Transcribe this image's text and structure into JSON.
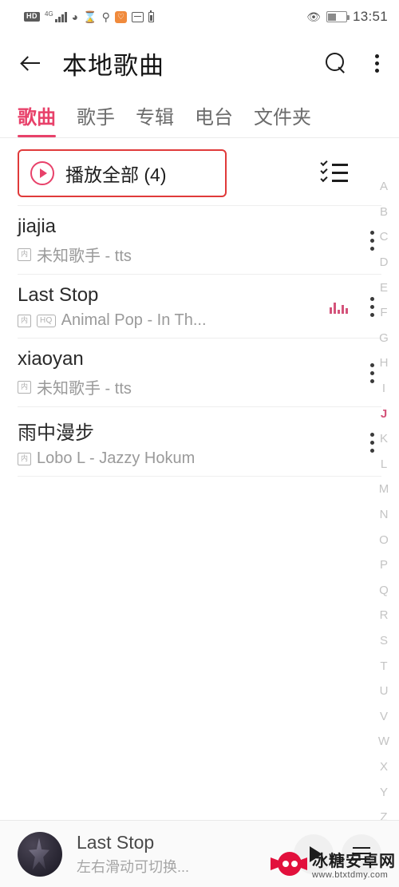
{
  "statusbar": {
    "hd_badge": "HD",
    "network": "4G",
    "icons": [
      "hd-badge",
      "signal-4g-icon",
      "wifi-icon",
      "hourglass-icon",
      "accessibility-icon",
      "orange-app-icon",
      "inbox-icon",
      "battery-small-icon"
    ],
    "eye_icon": "eye-icon",
    "battery_level": 40,
    "time": "13:51"
  },
  "header": {
    "back_label": "←",
    "title": "本地歌曲",
    "search_icon": "search-icon",
    "menu_icon": "kebab-menu-icon"
  },
  "tabs": {
    "items": [
      {
        "label": "歌曲",
        "active": true
      },
      {
        "label": "歌手",
        "active": false
      },
      {
        "label": "专辑",
        "active": false
      },
      {
        "label": "电台",
        "active": false
      },
      {
        "label": "文件夹",
        "active": false
      }
    ],
    "accent": "#e8416a"
  },
  "playall": {
    "label": "播放全部 (4)",
    "count": 4,
    "highlight_color": "#e03a3a",
    "play_icon": "play-circle-icon",
    "multiselect_icon": "checklist-icon"
  },
  "songs": [
    {
      "title": "jiajia",
      "artist": "未知歌手 - tts",
      "badge_file": "内",
      "hq": false,
      "playing": false
    },
    {
      "title": "Last Stop",
      "artist": "Animal Pop - In Th...",
      "badge_file": "内",
      "hq": true,
      "hq_label": "HQ",
      "playing": true
    },
    {
      "title": "xiaoyan",
      "artist": "未知歌手 - tts",
      "badge_file": "内",
      "hq": false,
      "playing": false
    },
    {
      "title": "雨中漫步",
      "artist": "Lobo L - Jazzy Hokum",
      "badge_file": "内",
      "hq": false,
      "playing": false
    }
  ],
  "alpha_index": {
    "letters": [
      "A",
      "B",
      "C",
      "D",
      "E",
      "F",
      "G",
      "H",
      "I",
      "J",
      "K",
      "L",
      "M",
      "N",
      "O",
      "P",
      "Q",
      "R",
      "S",
      "T",
      "U",
      "V",
      "W",
      "X",
      "Y",
      "Z",
      "#"
    ],
    "active": "J",
    "active_color": "#d4537a"
  },
  "player": {
    "title": "Last Stop",
    "subtitle": "左右滑动可切换...",
    "album_art": "album-art-image",
    "play_icon": "play-button-icon",
    "playlist_icon": "playlist-button-icon"
  },
  "watermark": {
    "name": "冰糖安卓网",
    "url": "www.btxtdmy.com"
  }
}
